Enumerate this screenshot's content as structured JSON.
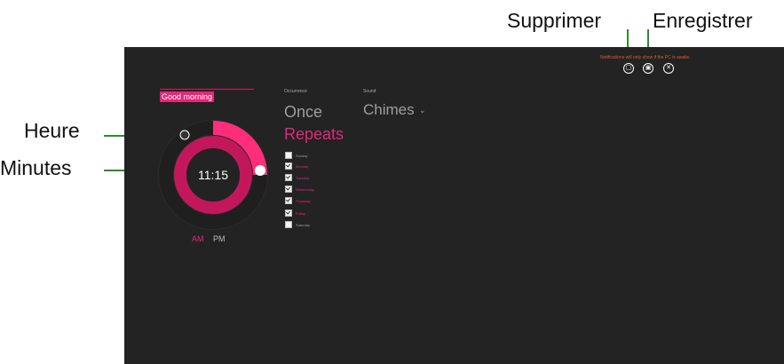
{
  "callouts": {
    "supprimer": "Supprimer",
    "enregistrer": "Enregistrer",
    "heure": "Heure",
    "minutes": "Minutes"
  },
  "alarm": {
    "name": "Good morning",
    "time": "11:15",
    "ampm": {
      "am": "AM",
      "pm": "PM",
      "selected": "AM"
    }
  },
  "occurrence": {
    "label": "Occurrence",
    "once": "Once",
    "repeats": "Repeats",
    "selected": "Repeats",
    "days": [
      {
        "label": "Sunday",
        "checked": false
      },
      {
        "label": "Monday",
        "checked": true
      },
      {
        "label": "Tuesday",
        "checked": true
      },
      {
        "label": "Wednesday",
        "checked": true
      },
      {
        "label": "Thursday",
        "checked": true
      },
      {
        "label": "Friday",
        "checked": true
      },
      {
        "label": "Saturday",
        "checked": false
      }
    ]
  },
  "sound": {
    "label": "Sound",
    "value": "Chimes",
    "chevron_icon": "chevron-down-icon"
  },
  "notification": {
    "text": "Notifications will only show if the PC is awake"
  },
  "top_actions": {
    "delete_icon": "trash-icon",
    "save_icon": "save-icon",
    "close_icon": "close-icon"
  },
  "colors": {
    "background": "#232323",
    "accent": "#e3277a",
    "hour_ring": "#c2185b",
    "minute_ring": "#ff2d7a"
  }
}
